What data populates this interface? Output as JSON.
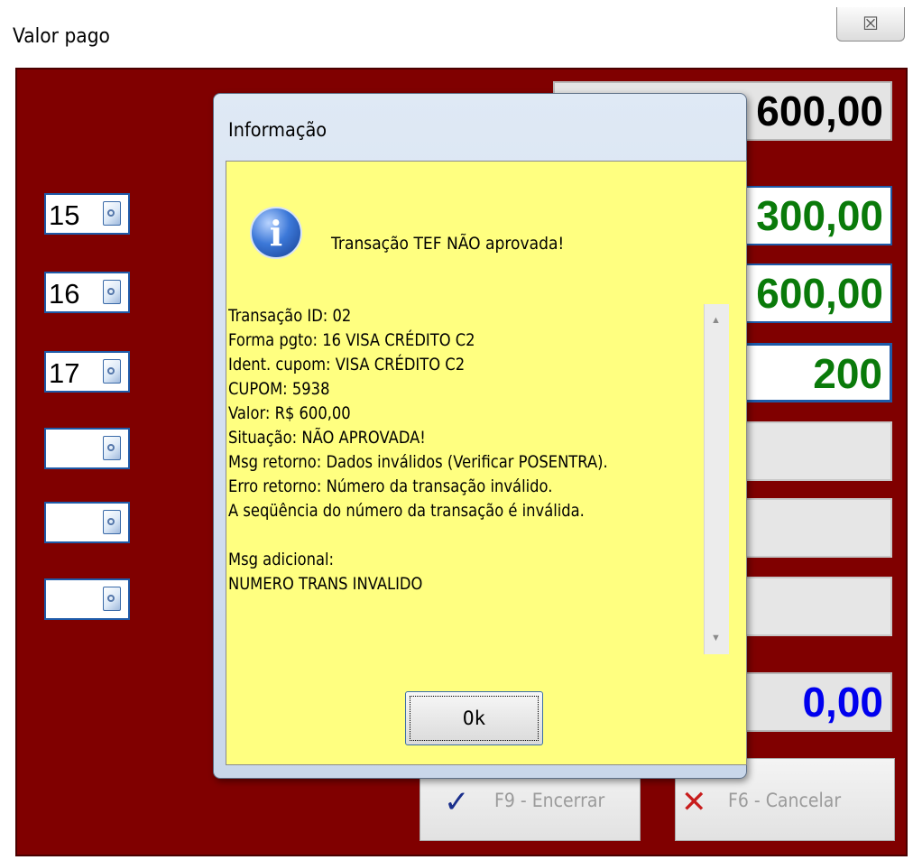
{
  "window": {
    "title": "Valor pago",
    "close_symbol": "☒"
  },
  "left_fields": [
    {
      "number": "15",
      "icon": "document-search-icon"
    },
    {
      "number": "16",
      "icon": "document-search-icon"
    },
    {
      "number": "17",
      "icon": "document-search-icon"
    },
    {
      "number": "",
      "icon": "document-search-icon"
    },
    {
      "number": "",
      "icon": "document-search-icon"
    },
    {
      "number": "",
      "icon": "document-search-icon"
    }
  ],
  "value_fields": {
    "total": "600,00",
    "paid_1": "300,00",
    "paid_2": "600,00",
    "quantity": "200",
    "change": "0,00"
  },
  "colors": {
    "panel": "#800000",
    "green_value": "#0a7a0a",
    "blue_value": "#0000ee",
    "dialog_body": "#ffff80"
  },
  "buttons": {
    "finish": {
      "label": "F9 - Encerrar",
      "glyph": "✓"
    },
    "cancel": {
      "label": "F6 - Cancelar",
      "glyph": "✕"
    }
  },
  "dialog": {
    "title": "Informação",
    "icon": "info-icon",
    "icon_glyph": "i",
    "headline": "Transação TEF NÃO aprovada!",
    "details": [
      "Transação ID: 02",
      "Forma pgto: 16 VISA CRÉDITO C2",
      "Ident. cupom: VISA CRÉDITO C2",
      "CUPOM: 5938",
      "Valor: R$ 600,00",
      "Situação: NÃO APROVADA!",
      "Msg retorno: Dados inválidos (Verificar POSENTRA).",
      "Erro retorno: Número da transação inválido.",
      "A seqüência do número da transação é inválida.",
      "",
      "Msg adicional:",
      "NUMERO TRANS INVALIDO"
    ],
    "ok_label": "Ok",
    "scroll_up": "▲",
    "scroll_down": "▼"
  }
}
